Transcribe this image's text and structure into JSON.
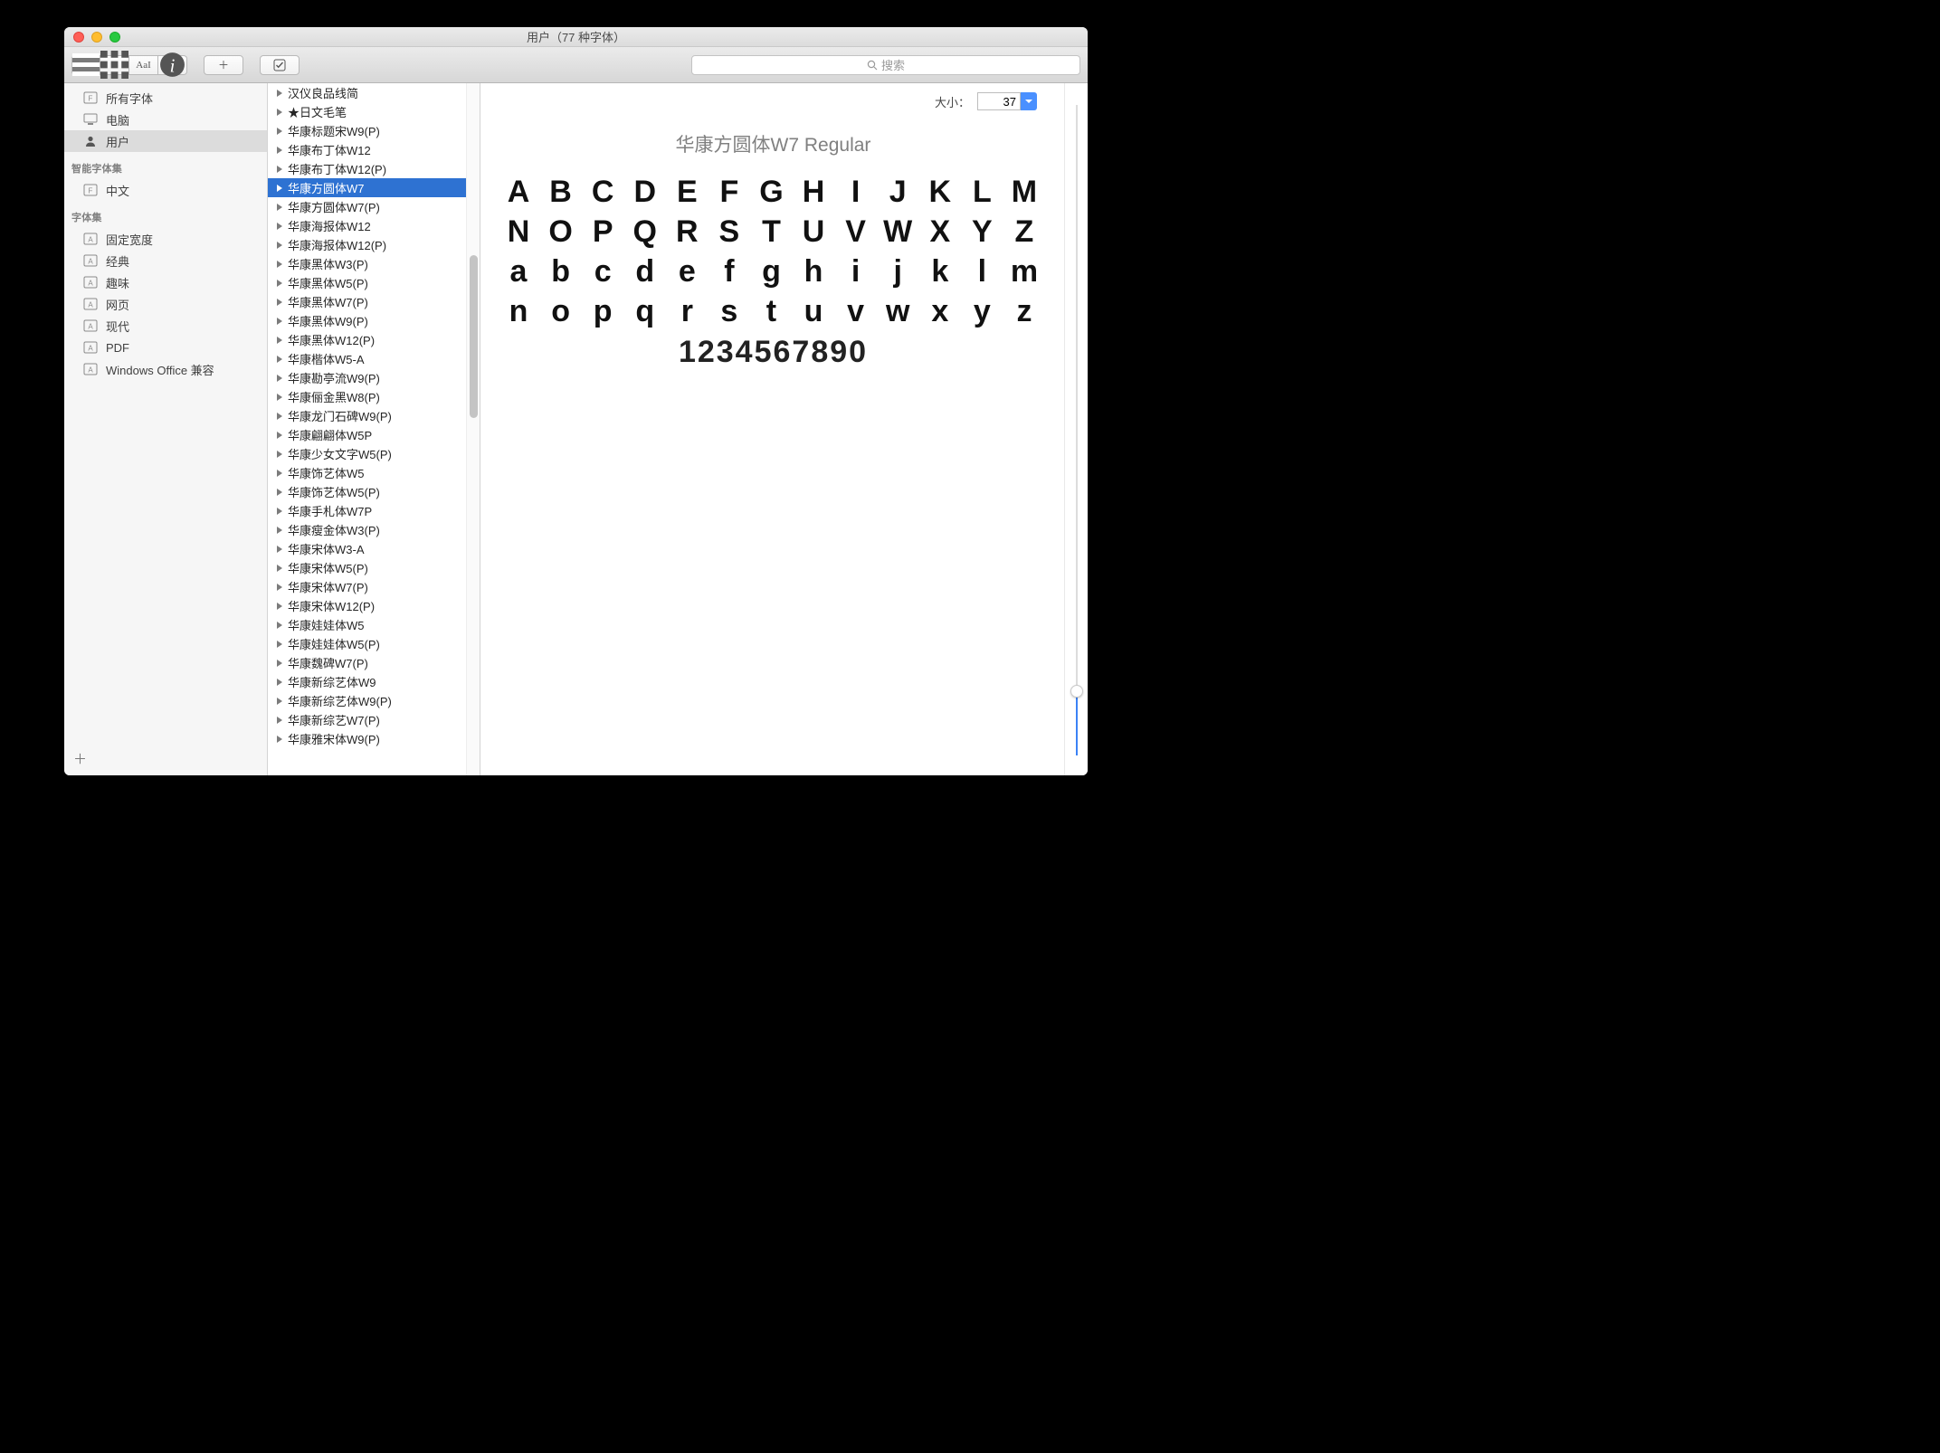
{
  "window": {
    "title": "用户（77 种字体）"
  },
  "toolbar": {
    "view_list": "≡",
    "view_grid": "⊞",
    "view_sample": "AaI",
    "info": "i",
    "add": "＋",
    "check": "✓"
  },
  "search": {
    "placeholder": "搜索"
  },
  "sidebar": {
    "collections": [
      {
        "icon": "font-icon",
        "label": "所有字体"
      },
      {
        "icon": "computer-icon",
        "label": "电脑"
      },
      {
        "icon": "user-icon",
        "label": "用户",
        "selected": true
      }
    ],
    "smart_header": "智能字体集",
    "smart": [
      {
        "icon": "font-icon",
        "label": "中文"
      }
    ],
    "sets_header": "字体集",
    "sets": [
      {
        "label": "固定宽度"
      },
      {
        "label": "经典"
      },
      {
        "label": "趣味"
      },
      {
        "label": "网页"
      },
      {
        "label": "现代"
      },
      {
        "label": "PDF"
      },
      {
        "label": "Windows Office 兼容"
      }
    ]
  },
  "fonts": [
    "汉仪良品线简",
    "★日文毛笔",
    "华康标题宋W9(P)",
    "华康布丁体W12",
    "华康布丁体W12(P)",
    "华康方圆体W7",
    "华康方圆体W7(P)",
    "华康海报体W12",
    "华康海报体W12(P)",
    "华康黑体W3(P)",
    "华康黑体W5(P)",
    "华康黑体W7(P)",
    "华康黑体W9(P)",
    "华康黑体W12(P)",
    "华康楷体W5-A",
    "华康勘亭流W9(P)",
    "华康俪金黑W8(P)",
    "华康龙门石碑W9(P)",
    "华康翩翩体W5P",
    "华康少女文字W5(P)",
    "华康饰艺体W5",
    "华康饰艺体W5(P)",
    "华康手札体W7P",
    "华康瘦金体W3(P)",
    "华康宋体W3-A",
    "华康宋体W5(P)",
    "华康宋体W7(P)",
    "华康宋体W12(P)",
    "华康娃娃体W5",
    "华康娃娃体W5(P)",
    "华康魏碑W7(P)",
    "华康新综艺体W9",
    "华康新综艺体W9(P)",
    "华康新综艺W7(P)",
    "华康雅宋体W9(P)"
  ],
  "selected_font_index": 5,
  "preview": {
    "size_label": "大小：",
    "size_value": "37",
    "title": "华康方圆体W7 Regular",
    "lines": [
      [
        "A",
        "B",
        "C",
        "D",
        "E",
        "F",
        "G",
        "H",
        "I",
        "J",
        "K",
        "L",
        "M"
      ],
      [
        "N",
        "O",
        "P",
        "Q",
        "R",
        "S",
        "T",
        "U",
        "V",
        "W",
        "X",
        "Y",
        "Z"
      ],
      [
        "a",
        "b",
        "c",
        "d",
        "e",
        "f",
        "g",
        "h",
        "i",
        "j",
        "k",
        "l",
        "m"
      ],
      [
        "n",
        "o",
        "p",
        "q",
        "r",
        "s",
        "t",
        "u",
        "v",
        "w",
        "x",
        "y",
        "z"
      ]
    ],
    "numbers": "1234567890"
  }
}
